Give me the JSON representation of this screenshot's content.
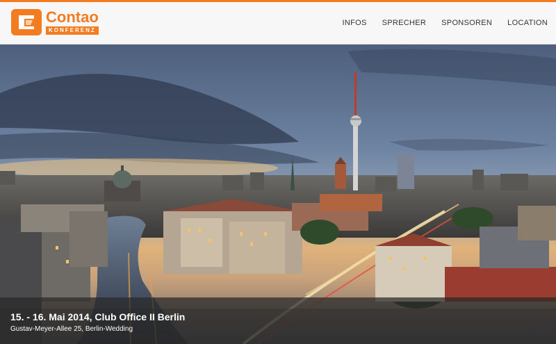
{
  "brand": {
    "name": "Contao",
    "subtitle": "KONFERENZ",
    "accent_color": "#f47c20",
    "logo_icon": "contao-logo-icon"
  },
  "nav": {
    "items": [
      {
        "label": "INFOS"
      },
      {
        "label": "SPRECHER"
      },
      {
        "label": "SPONSOREN"
      },
      {
        "label": "LOCATION"
      }
    ]
  },
  "hero": {
    "image": "berlin-skyline-photo",
    "title": "15. - 16. Mai 2014, Club Office II Berlin",
    "address": "Gustav-Meyer-Allee 25, Berlin-Wedding"
  }
}
